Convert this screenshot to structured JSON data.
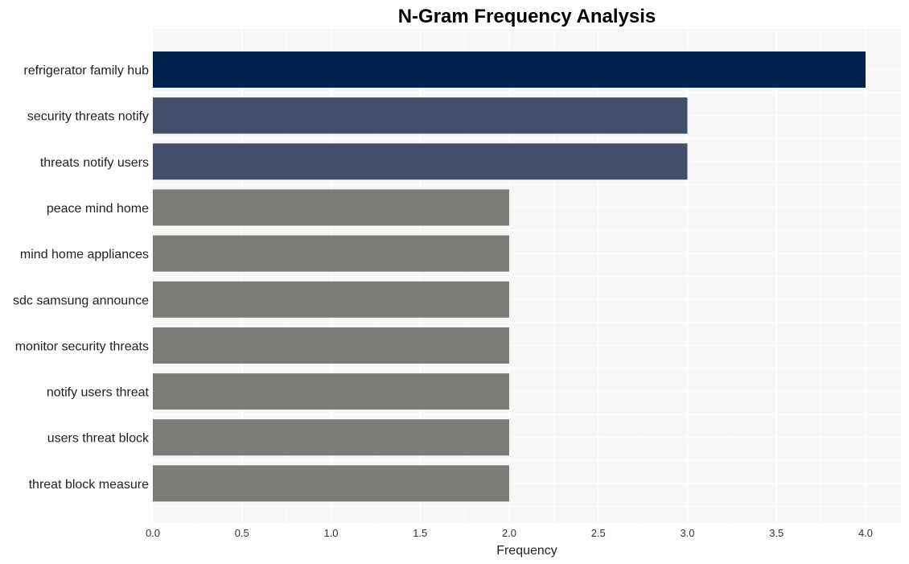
{
  "chart_data": {
    "type": "bar",
    "orientation": "horizontal",
    "title": "N-Gram Frequency Analysis",
    "xlabel": "Frequency",
    "ylabel": "",
    "xlim": [
      0,
      4.2
    ],
    "xticks": [
      "0.0",
      "0.5",
      "1.0",
      "1.5",
      "2.0",
      "2.5",
      "3.0",
      "3.5",
      "4.0"
    ],
    "grid": true,
    "categories": [
      "refrigerator family hub",
      "security threats notify",
      "threats notify users",
      "peace mind home",
      "mind home appliances",
      "sdc samsung announce",
      "monitor security threats",
      "notify users threat",
      "users threat block",
      "threat block measure"
    ],
    "values": [
      4,
      3,
      3,
      2,
      2,
      2,
      2,
      2,
      2,
      2
    ],
    "colors": [
      "#00224e",
      "#434e6c",
      "#434e6c",
      "#7c7b78",
      "#7c7b78",
      "#7c7b78",
      "#7c7b78",
      "#7c7b78",
      "#7c7b78",
      "#7c7b78"
    ],
    "background": "#f7f7f7"
  }
}
